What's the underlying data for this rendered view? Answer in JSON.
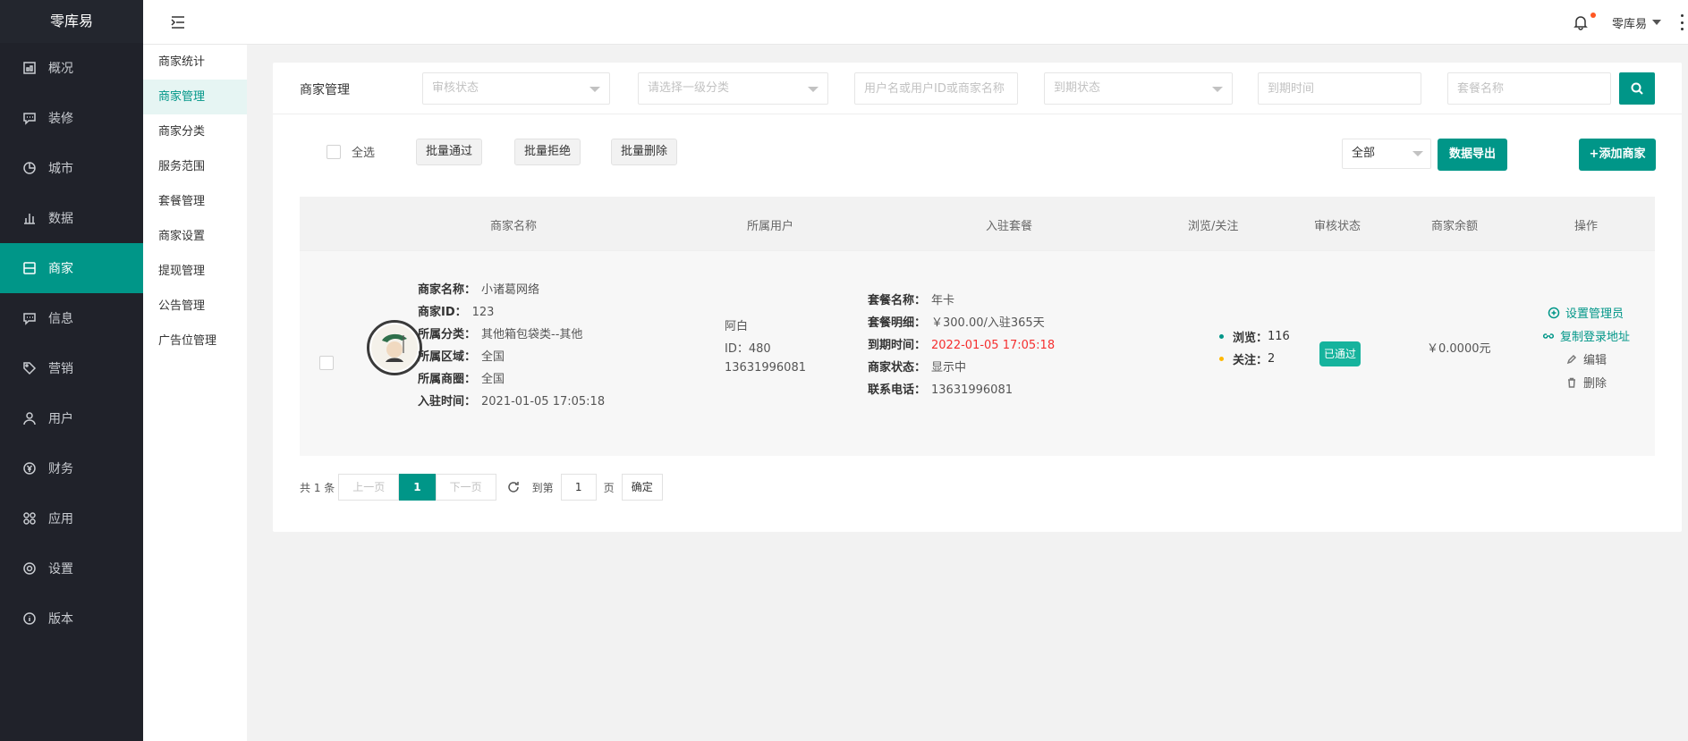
{
  "app": {
    "logo": "零库易"
  },
  "sidebar": {
    "items": [
      {
        "label": "概况",
        "icon": "dashboard-icon"
      },
      {
        "label": "装修",
        "icon": "chat-icon"
      },
      {
        "label": "城市",
        "icon": "location-icon"
      },
      {
        "label": "数据",
        "icon": "bar-chart-icon"
      },
      {
        "label": "商家",
        "icon": "store-icon",
        "active": true
      },
      {
        "label": "信息",
        "icon": "message-icon"
      },
      {
        "label": "营销",
        "icon": "tag-icon"
      },
      {
        "label": "用户",
        "icon": "user-icon"
      },
      {
        "label": "财务",
        "icon": "yen-icon"
      },
      {
        "label": "应用",
        "icon": "apps-icon"
      },
      {
        "label": "设置",
        "icon": "gear-icon"
      },
      {
        "label": "版本",
        "icon": "info-icon"
      }
    ]
  },
  "header": {
    "user": "零库易"
  },
  "submenu": {
    "items": [
      "商家统计",
      "商家管理",
      "商家分类",
      "服务范围",
      "套餐管理",
      "商家设置",
      "提现管理",
      "公告管理",
      "广告位管理"
    ],
    "active_index": 1
  },
  "filters": {
    "title": "商家管理",
    "audit_status_placeholder": "审核状态",
    "category_placeholder": "请选择一级分类",
    "user_search_placeholder": "用户名或用户ID或商家名称",
    "expire_status_placeholder": "到期状态",
    "expire_time_placeholder": "到期时间",
    "package_name_placeholder": "套餐名称"
  },
  "toolbar": {
    "select_all": "全选",
    "batch_approve": "批量通过",
    "batch_reject": "批量拒绝",
    "batch_delete": "批量删除",
    "status_filter": "全部",
    "export": "数据导出",
    "add_merchant": "+添加商家"
  },
  "table": {
    "headers": {
      "merchant_name": "商家名称",
      "owner": "所属用户",
      "package": "入驻套餐",
      "views_follows": "浏览/关注",
      "audit_status": "审核状态",
      "balance": "商家余额",
      "actions": "操作"
    },
    "row": {
      "merchant": {
        "name_label": "商家名称：",
        "name": "小诸葛网络",
        "id_label": "商家ID：",
        "id": "123",
        "category_label": "所属分类：",
        "category": "其他箱包袋类--其他",
        "region_label": "所属区域：",
        "region": "全国",
        "district_label": "所属商圈：",
        "district": "全国",
        "join_label": "入驻时间：",
        "join_time": "2021-01-05 17:05:18"
      },
      "owner": {
        "name": "阿白",
        "id": "ID：480",
        "phone": "13631996081"
      },
      "package": {
        "name_label": "套餐名称：",
        "name": "年卡",
        "detail_label": "套餐明细：",
        "detail": "￥300.00/入驻365天",
        "expire_label": "到期时间：",
        "expire": "2022-01-05 17:05:18",
        "status_label": "商家状态：",
        "status": "显示中",
        "phone_label": "联系电话：",
        "phone": "13631996081"
      },
      "stats": {
        "views_label": "浏览：",
        "views": "116",
        "follows_label": "关注：",
        "follows": "2"
      },
      "audit_status": "已通过",
      "balance": "￥0.0000元",
      "actions": {
        "set_admin": "设置管理员",
        "copy_login": "复制登录地址",
        "edit": "编辑",
        "delete": "删除"
      }
    }
  },
  "pagination": {
    "total": "共 1 条",
    "prev": "上一页",
    "current": "1",
    "next": "下一页",
    "goto_label": "到第",
    "goto_value": "1",
    "page_unit": "页",
    "confirm": "确定"
  },
  "colors": {
    "accent": "#009688",
    "sidebar_bg": "#20222a",
    "danger": "#f52f2f",
    "badge": "#16b39d"
  }
}
